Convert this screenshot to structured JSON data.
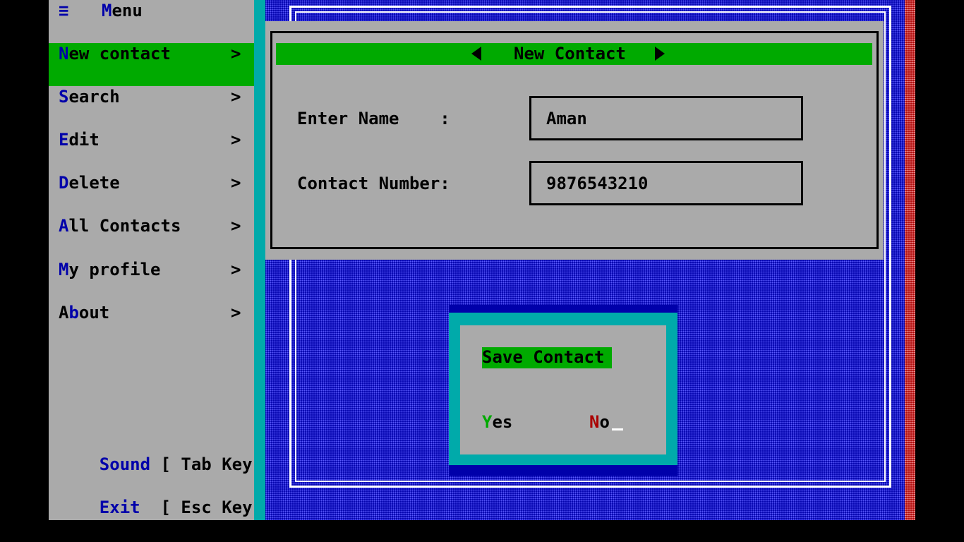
{
  "menu": {
    "icon": "hamburger-icon",
    "title_hotkey": "M",
    "title_rest": "enu",
    "items": [
      {
        "hotkey": "N",
        "rest": "ew contact",
        "chevron": ">",
        "active": true
      },
      {
        "hotkey": "S",
        "rest": "earch",
        "chevron": ">"
      },
      {
        "hotkey": "E",
        "rest": "dit",
        "chevron": ">"
      },
      {
        "hotkey": "D",
        "rest": "elete",
        "chevron": ">"
      },
      {
        "hotkey": "A",
        "rest": "ll Contacts",
        "chevron": ">"
      },
      {
        "hotkey": "M",
        "rest": "y profile",
        "chevron": ">"
      },
      {
        "pre": "A",
        "hotkey": "b",
        "rest": "out",
        "chevron": ">"
      }
    ],
    "sound": {
      "label": "Sound",
      "key": " [ Tab Key ]"
    },
    "exit": {
      "label": "Exit",
      "key": "  [ Esc Key ]"
    }
  },
  "form": {
    "title": "New Contact",
    "prev_icon": "triangle-left-icon",
    "next_icon": "triangle-right-icon",
    "name_label": "Enter Name    :",
    "name_value": "Aman",
    "number_label": "Contact Number:",
    "number_value": "9876543210"
  },
  "dialog": {
    "title": "Save Contact",
    "yes_hotkey": "Y",
    "yes_rest": "es",
    "no_hotkey": "N",
    "no_rest": "o"
  },
  "colors": {
    "sidebar": "#aaaaaa",
    "desktop": "#0000aa",
    "highlight": "#00aa00",
    "hotkey": "#0000aa",
    "no_hotkey": "#aa0000",
    "cyan": "#00aaaa"
  }
}
